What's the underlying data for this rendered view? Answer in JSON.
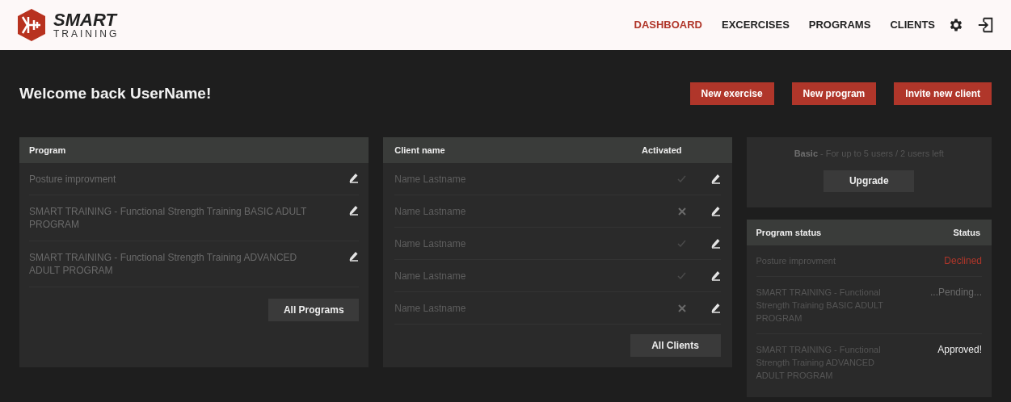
{
  "brand": {
    "name": "SMART",
    "subtitle": "TRAINING"
  },
  "nav": [
    {
      "label": "DASHBOARD",
      "selected": true
    },
    {
      "label": "EXCERCISES",
      "selected": false
    },
    {
      "label": "PROGRAMS",
      "selected": false
    },
    {
      "label": "CLIENTS",
      "selected": false
    }
  ],
  "welcome": "Welcome back UserName!",
  "actions": [
    "New exercise",
    "New program",
    "Invite new client"
  ],
  "programs": {
    "heading": "Program",
    "rows": [
      "Posture improvment",
      "SMART TRAINING - Functional Strength Training BASIC ADULT PROGRAM",
      "SMART TRAINING - Functional Strength Training ADVANCED ADULT PROGRAM"
    ],
    "button": "All Programs"
  },
  "clients": {
    "columns": [
      "Client name",
      "Activated"
    ],
    "rows": [
      {
        "name": "Name Lastname",
        "activated": true
      },
      {
        "name": "Name Lastname",
        "activated": false
      },
      {
        "name": "Name Lastname",
        "activated": true
      },
      {
        "name": "Name Lastname",
        "activated": true
      },
      {
        "name": "Name Lastname",
        "activated": false
      }
    ],
    "button": "All Clients"
  },
  "plan": {
    "text": "**Basic** - For up to 5 users / 2 users left",
    "button": "Upgrade"
  },
  "program_status": {
    "columns": [
      "Program status",
      "Status"
    ],
    "rows": [
      {
        "program": "Posture improvment",
        "status": "Declined",
        "kind": "declined"
      },
      {
        "program": "SMART TRAINING - Functional Strength Training BASIC ADULT PROGRAM",
        "status": "...Pending...",
        "kind": "pending"
      },
      {
        "program": "SMART TRAINING - Functional Strength Training ADVANCED ADULT PROGRAM",
        "status": "Approved!",
        "kind": "approved"
      }
    ]
  }
}
